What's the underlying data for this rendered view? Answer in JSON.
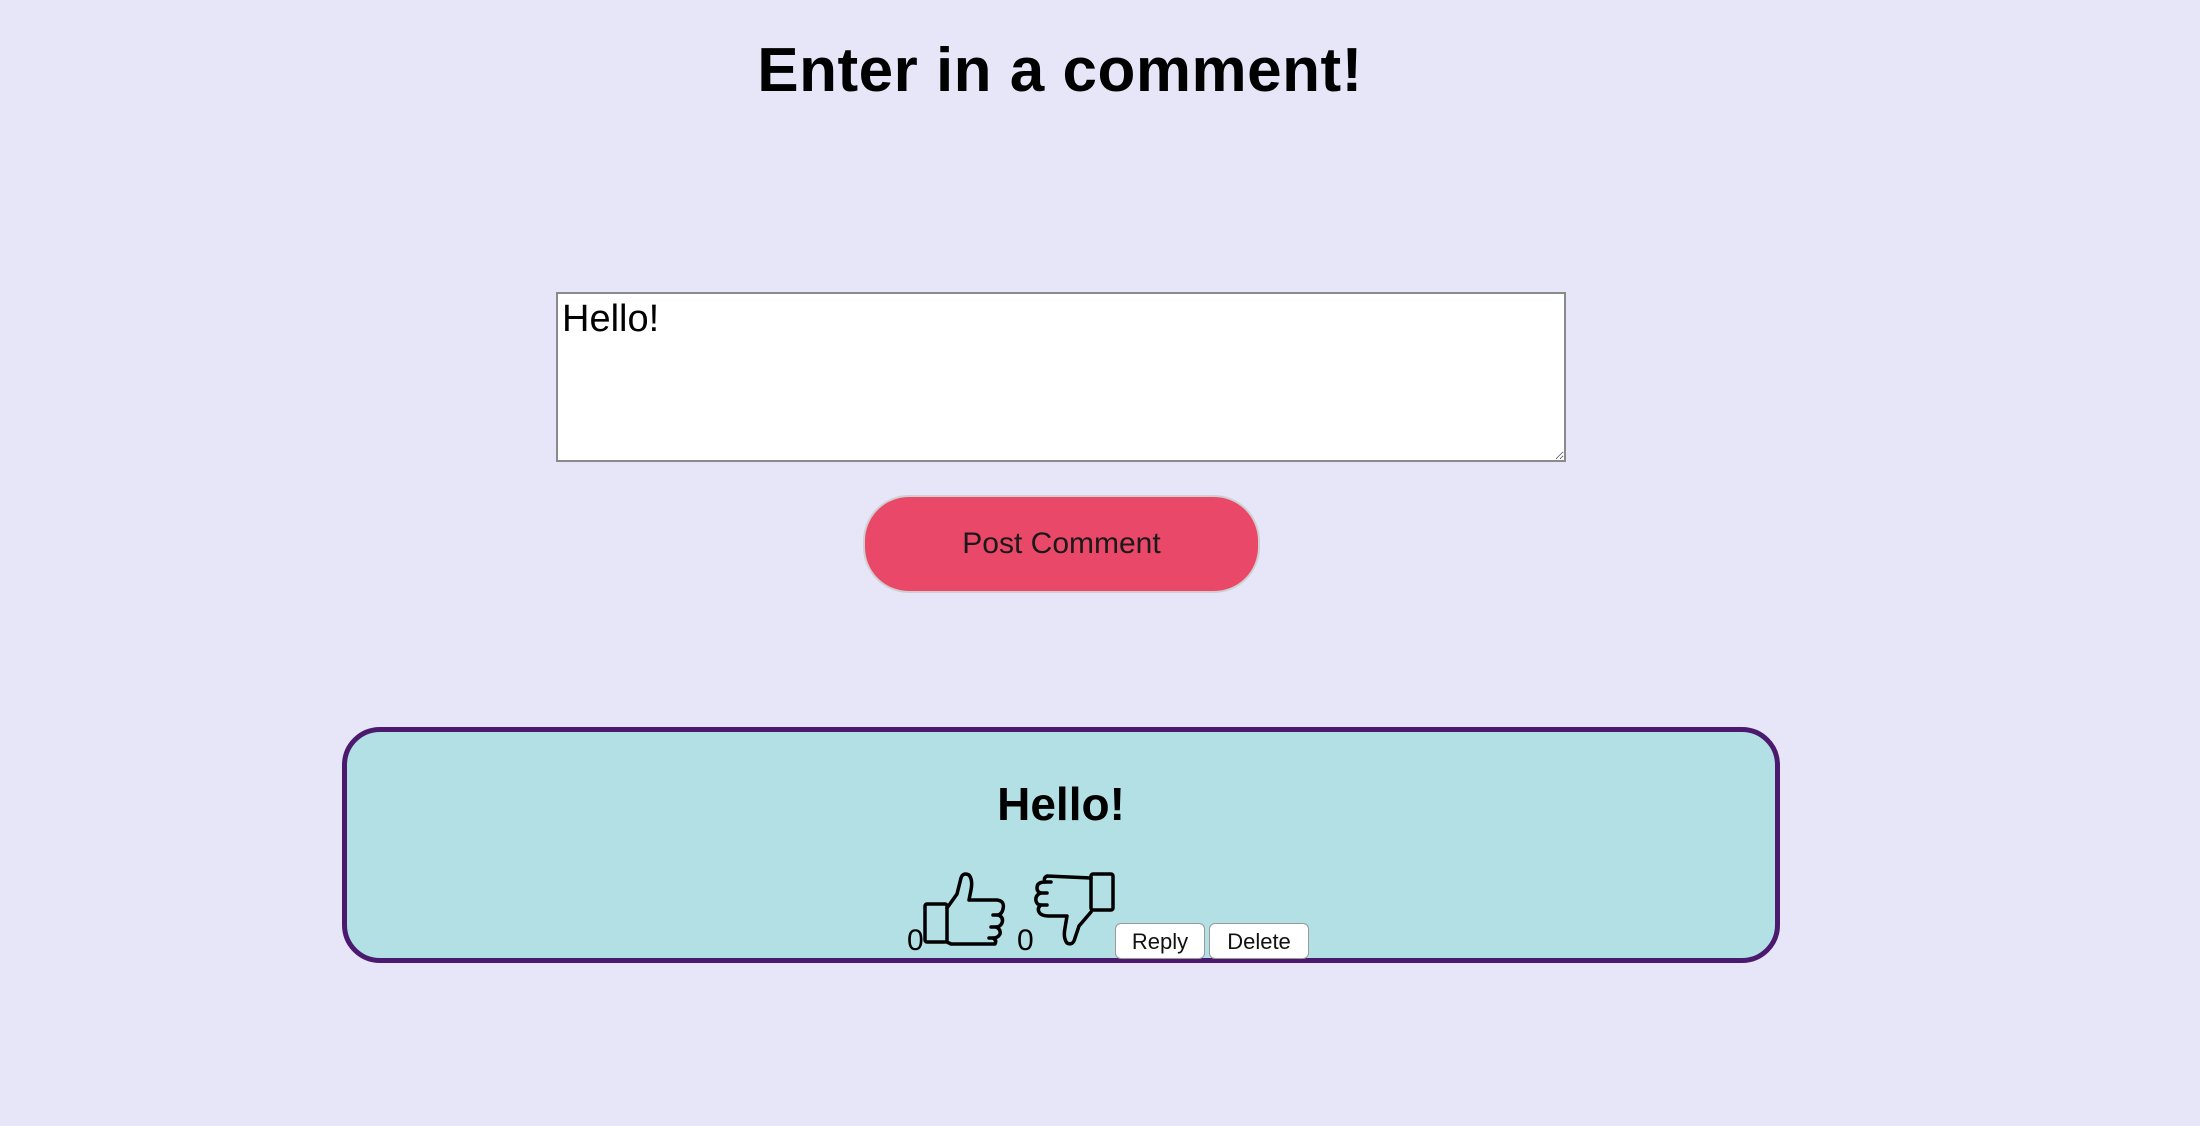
{
  "header": {
    "title": "Enter in a comment!"
  },
  "composer": {
    "input_value": "Hello!",
    "post_label": "Post Comment"
  },
  "comments": [
    {
      "text": "Hello!",
      "likes": "0",
      "dislikes": "0",
      "reply_label": "Reply",
      "delete_label": "Delete",
      "icons": {
        "like": "thumbs-up-icon",
        "dislike": "thumbs-down-icon"
      }
    }
  ],
  "colors": {
    "background": "#e6e6f8",
    "post_button": "#ea4869",
    "card_background": "#b2e0e4",
    "card_border": "#4b1a6e"
  }
}
